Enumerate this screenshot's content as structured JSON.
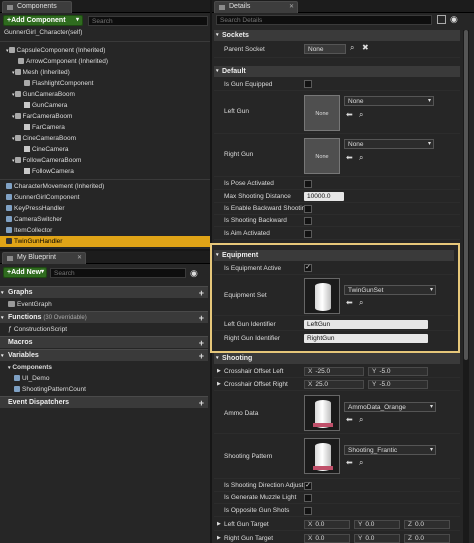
{
  "components_panel": {
    "tab_label": "Components",
    "add_component_label": "+Add Component",
    "search_placeholder": "Search",
    "root_label": "GunnerGirl_Character(self)",
    "tree": [
      {
        "label": "CapsuleComponent (Inherited)",
        "icon": "capsule-icon"
      },
      {
        "label": "ArrowComponent (Inherited)",
        "icon": "arrow-icon"
      },
      {
        "label": "Mesh (Inherited)",
        "icon": "mesh-icon"
      },
      {
        "label": "FlashlightComponent",
        "icon": "light-icon"
      },
      {
        "label": "GunCameraBoom",
        "icon": "boom-icon"
      },
      {
        "label": "GunCamera",
        "icon": "camera-icon"
      },
      {
        "label": "FarCameraBoom",
        "icon": "boom-icon"
      },
      {
        "label": "FarCamera",
        "icon": "camera-icon"
      },
      {
        "label": "CineCameraBoom",
        "icon": "boom-icon"
      },
      {
        "label": "CineCamera",
        "icon": "camera-icon"
      },
      {
        "label": "FollowCameraBoom",
        "icon": "boom-icon"
      },
      {
        "label": "FollowCamera",
        "icon": "camera-icon"
      },
      {
        "label": "CharacterMovement (Inherited)",
        "icon": "movement-icon"
      },
      {
        "label": "GunnerGirlComponent",
        "icon": "component-icon"
      },
      {
        "label": "KeyPressHandler",
        "icon": "component-icon"
      },
      {
        "label": "CameraSwitcher",
        "icon": "component-icon"
      },
      {
        "label": "ItemCollector",
        "icon": "component-icon"
      },
      {
        "label": "TwinGunHandler",
        "icon": "component-icon"
      }
    ]
  },
  "blueprint_panel": {
    "tab_label": "My Blueprint",
    "add_new_label": "+Add New",
    "search_placeholder": "Search",
    "graphs_label": "Graphs",
    "event_graph_label": "EventGraph",
    "functions_label": "Functions",
    "functions_overridable": "(30 Overridable)",
    "construction_script_label": "ConstructionScript",
    "macros_label": "Macros",
    "variables_label": "Variables",
    "components_label": "Components",
    "variables": [
      "UI_Demo",
      "ShootingPatternCount"
    ],
    "event_dispatchers_label": "Event Dispatchers"
  },
  "details_panel": {
    "tab_label": "Details",
    "search_placeholder": "Search Details",
    "sockets": {
      "title": "Sockets",
      "parent_socket_label": "Parent Socket",
      "parent_socket_value": "None"
    },
    "default": {
      "title": "Default",
      "is_gun_equipped_label": "Is Gun Equipped",
      "left_gun_label": "Left Gun",
      "left_gun_thumb": "None",
      "left_gun_value": "None",
      "right_gun_label": "Right Gun",
      "right_gun_thumb": "None",
      "right_gun_value": "None",
      "is_pose_activated_label": "Is Pose Activated",
      "max_shooting_distance_label": "Max Shooting Distance",
      "max_shooting_distance_value": "10000.0",
      "is_enable_backward_label": "Is Enable Backward Shootin",
      "is_shooting_backward_label": "Is Shooting Backward",
      "is_aim_activated_label": "Is Aim Activated"
    },
    "equipment": {
      "title": "Equipment",
      "is_equipment_active_label": "Is Equipment Active",
      "equipment_set_label": "Equipment Set",
      "equipment_set_value": "TwinGunSet",
      "left_gun_identifier_label": "Left Gun Identifier",
      "left_gun_identifier_value": "LeftGun",
      "right_gun_identifier_label": "Right Gun Identifier",
      "right_gun_identifier_value": "RightGun"
    },
    "shooting": {
      "title": "Shooting",
      "crosshair_left_label": "Crosshair Offset Left",
      "crosshair_left_x": "-25.0",
      "crosshair_left_y": "-5.0",
      "crosshair_right_label": "Crosshair Offset Right",
      "crosshair_right_x": "25.0",
      "crosshair_right_y": "-5.0",
      "ammo_data_label": "Ammo Data",
      "ammo_data_value": "AmmoData_Orange",
      "shooting_pattern_label": "Shooting Pattern",
      "shooting_pattern_value": "Shooting_Frantic",
      "is_shooting_direction_label": "Is Shooting Direction Adjust",
      "is_generate_muzzle_label": "Is Generate Muzzle Light",
      "is_opposite_gun_label": "Is Opposite Gun Shots",
      "left_gun_target_label": "Left Gun Target",
      "left_gun_target": [
        "0.0",
        "0.0",
        "0.0"
      ],
      "right_gun_target_label": "Right Gun Target",
      "right_gun_target": [
        "0.0",
        "0.0",
        "0.0"
      ]
    }
  },
  "colors": {
    "accent_selection": "#e0a417",
    "highlight_border": "#e6c77a",
    "add_button": "#2f6b1f"
  }
}
